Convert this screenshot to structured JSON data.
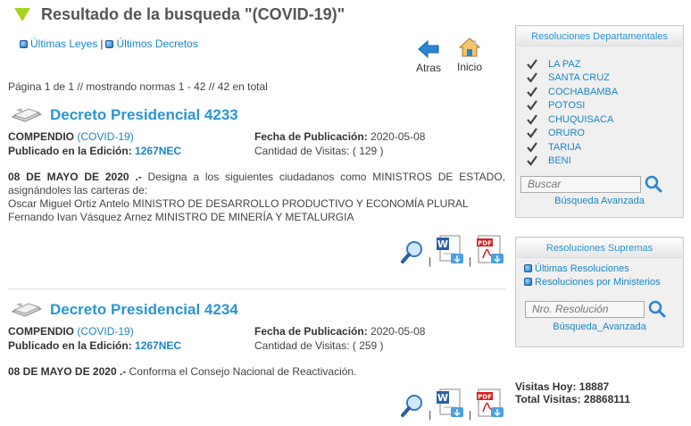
{
  "page": {
    "title": "Resultado de la busqueda \"(COVID-19)\""
  },
  "toplinks": {
    "laws": "Últimas Leyes",
    "separator": "|",
    "decrees": "Últimos Decretos"
  },
  "nav": {
    "back_label": "Atras",
    "home_label": "Inicio"
  },
  "pagination": {
    "text": "Página 1 de 1 // mostrando normas 1 - 42 // 42 en total"
  },
  "results": [
    {
      "title": "Decreto Presidencial 4233",
      "compendio_label": "COMPENDIO",
      "compendio_value": "(COVID-19)",
      "edicion_label": "Publicado en la Edición:",
      "edicion_value": "1267NEC",
      "fecha_label": "Fecha de Publicación:",
      "fecha_value": "2020-05-08",
      "visitas_label": "Cantidad de Visitas:",
      "visitas_value": "( 129 )",
      "date_heading": "08 DE MAYO DE 2020 .-",
      "summary": "Designa a los siguientes ciudadanos como MINISTROS DE ESTADO, asignándoles las carteras de:",
      "lines": [
        "Oscar Miguel Ortiz Antelo MINISTRO DE DESARROLLO PRODUCTIVO Y ECONOMÍA PLURAL",
        "Fernando Ivan Vásquez Arnez MINISTRO DE MINERÍA Y METALURGIA"
      ]
    },
    {
      "title": "Decreto Presidencial 4234",
      "compendio_label": "COMPENDIO",
      "compendio_value": "(COVID-19)",
      "edicion_label": "Publicado en la Edición:",
      "edicion_value": "1267NEC",
      "fecha_label": "Fecha de Publicación:",
      "fecha_value": "2020-05-08",
      "visitas_label": "Cantidad de Visitas:",
      "visitas_value": "( 259 )",
      "date_heading": "08 DE MAYO DE 2020 .-",
      "summary": "Conforma el Consejo Nacional de Reactivación.",
      "lines": []
    }
  ],
  "icons": {
    "separator": "|",
    "pdf_badge": "PDF",
    "word_letter": "W"
  },
  "sidebar": {
    "departamentales": {
      "title": "Resoluciones Departamentales",
      "items": [
        "LA PAZ",
        "SANTA CRUZ",
        "COCHABAMBA",
        "POTOSI",
        "CHUQUISACA",
        "ORURO",
        "TARIJA",
        "BENI"
      ],
      "search_placeholder": "Buscar",
      "advanced": "Búsqueda Avanzada"
    },
    "supremas": {
      "title": "Resoluciones Supremas",
      "links": [
        "Últimas Resoluciones",
        "Resoluciones por Ministerios"
      ],
      "search_placeholder": "Nro. Resolución",
      "advanced": "Búsqueda_Avanzada"
    }
  },
  "stats": {
    "today": "Visitas Hoy: 18887",
    "total": "Total Visitas: 28868111"
  },
  "colors": {
    "accent_blue": "#2a95d8",
    "link_blue": "#1a86c8",
    "triangle_green": "#a6d51e"
  }
}
